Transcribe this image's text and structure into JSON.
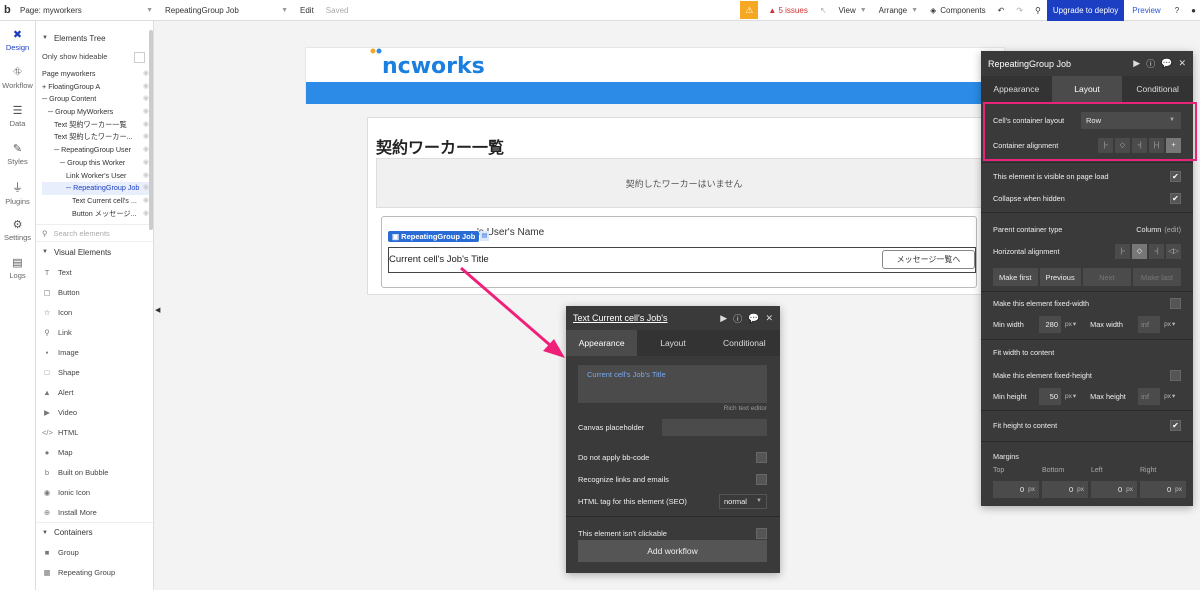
{
  "topbar": {
    "logo": "b",
    "page": "Page: myworkers",
    "element": "RepeatingGroup Job",
    "edit": "Edit",
    "saved": "Saved",
    "warn_icon": "warning-icon",
    "issues": "5 issues",
    "view": "View",
    "arrange": "Arrange",
    "components": "Components",
    "upgrade": "Upgrade to deploy",
    "preview": "Preview"
  },
  "leftnav": [
    {
      "label": "Design",
      "icon": "design-icon",
      "glyph": "✖"
    },
    {
      "label": "Workflow",
      "icon": "workflow-icon",
      "glyph": "⛗"
    },
    {
      "label": "Data",
      "icon": "data-icon",
      "glyph": "☰"
    },
    {
      "label": "Styles",
      "icon": "brush-icon",
      "glyph": "✎"
    },
    {
      "label": "Plugins",
      "icon": "plug-icon",
      "glyph": "⏚"
    },
    {
      "label": "Settings",
      "icon": "gear-icon",
      "glyph": "⚙"
    },
    {
      "label": "Logs",
      "icon": "document-icon",
      "glyph": "▤"
    }
  ],
  "palette": {
    "tree_title": "Elements Tree",
    "only_hideable": "Only show hideable",
    "tree": [
      {
        "label": "Page myworkers",
        "indent": 0
      },
      {
        "label": "+ FloatingGroup A",
        "indent": 0
      },
      {
        "label": "─ Group Content",
        "indent": 0
      },
      {
        "label": "─ Group MyWorkers",
        "indent": 1
      },
      {
        "label": "Text 契約ワーカー一覧",
        "indent": 2
      },
      {
        "label": "Text 契約したワーカー...",
        "indent": 2
      },
      {
        "label": "─ RepeatingGroup User",
        "indent": 2
      },
      {
        "label": "─ Group this Worker",
        "indent": 3
      },
      {
        "label": "Link Worker's User",
        "indent": 4
      },
      {
        "label": "─ RepeatingGroup Job",
        "indent": 4,
        "selected": true
      },
      {
        "label": "Text Current cell's ...",
        "indent": 5
      },
      {
        "label": "Button メッセージ...",
        "indent": 5
      }
    ],
    "search_placeholder": "Search elements",
    "visual_title": "Visual Elements",
    "visual": [
      {
        "label": "Text",
        "glyph": "T"
      },
      {
        "label": "Button",
        "glyph": "▢"
      },
      {
        "label": "Icon",
        "glyph": "☆"
      },
      {
        "label": "Link",
        "glyph": "⚲"
      },
      {
        "label": "Image",
        "glyph": "▪"
      },
      {
        "label": "Shape",
        "glyph": "□"
      },
      {
        "label": "Alert",
        "glyph": "▲"
      },
      {
        "label": "Video",
        "glyph": "▶"
      },
      {
        "label": "HTML",
        "glyph": "</>"
      },
      {
        "label": "Map",
        "glyph": "●"
      },
      {
        "label": "Built on Bubble",
        "glyph": "b"
      },
      {
        "label": "Ionic Icon",
        "glyph": "◉"
      },
      {
        "label": "Install More",
        "glyph": "⊕"
      }
    ],
    "containers_title": "Containers",
    "containers": [
      {
        "label": "Group",
        "glyph": "■"
      },
      {
        "label": "Repeating Group",
        "glyph": "▦"
      }
    ]
  },
  "canvas": {
    "logo": "ncworks",
    "page_title": "契約ワーカー一覧",
    "empty_message": "契約したワーカーはいません",
    "rg_user_text": "'s User's Name",
    "rg_badge": "RepeatingGroup Job",
    "cell_title": "Current cell's Job's Title",
    "cell_button": "メッセージ一覧へ"
  },
  "text_panel": {
    "title": "Text Current cell's Job's",
    "tabs": [
      "Appearance",
      "Layout",
      "Conditional"
    ],
    "rte_value": "Current cell's Job's Title",
    "rte_caption": "Rich text editor",
    "canvas_placeholder": "Canvas placeholder",
    "no_bbcode": "Do not apply bb-code",
    "recognize_links": "Recognize links and emails",
    "html_tag_label": "HTML tag for this element (SEO)",
    "html_tag_value": "normal",
    "not_clickable": "This element isn't clickable",
    "add_workflow": "Add workflow"
  },
  "rg_panel": {
    "title": "RepeatingGroup Job",
    "tabs": [
      "Appearance",
      "Layout",
      "Conditional"
    ],
    "container_layout_label": "Cell's container layout",
    "container_layout_value": "Row",
    "container_alignment_label": "Container alignment",
    "visible_on_load": "This element is visible on page load",
    "collapse_hidden": "Collapse when hidden",
    "parent_type_label": "Parent container type",
    "parent_type_value": "Column",
    "parent_type_edit": "(edit)",
    "h_align_label": "Horizontal alignment",
    "make_first": "Make first",
    "previous": "Previous",
    "next": "Next",
    "make_last": "Make last",
    "fixed_width": "Make this element fixed-width",
    "min_width_label": "Min width",
    "min_width_value": "280",
    "max_width_label": "Max width",
    "max_width_value": "inf",
    "unit_px": "px",
    "fit_width": "Fit width to content",
    "fixed_height": "Make this element fixed-height",
    "min_height_label": "Min height",
    "min_height_value": "50",
    "max_height_label": "Max height",
    "max_height_value": "inf",
    "fit_height": "Fit height to content",
    "margins_label": "Margins",
    "margin_top": "Top",
    "margin_bottom": "Bottom",
    "margin_left": "Left",
    "margin_right": "Right",
    "margin_value": "0"
  },
  "colors": {
    "accent": "#1b3ec2",
    "highlight": "#e8237a",
    "arrow": "#f0207a",
    "brand_blue": "#2b8be6"
  }
}
